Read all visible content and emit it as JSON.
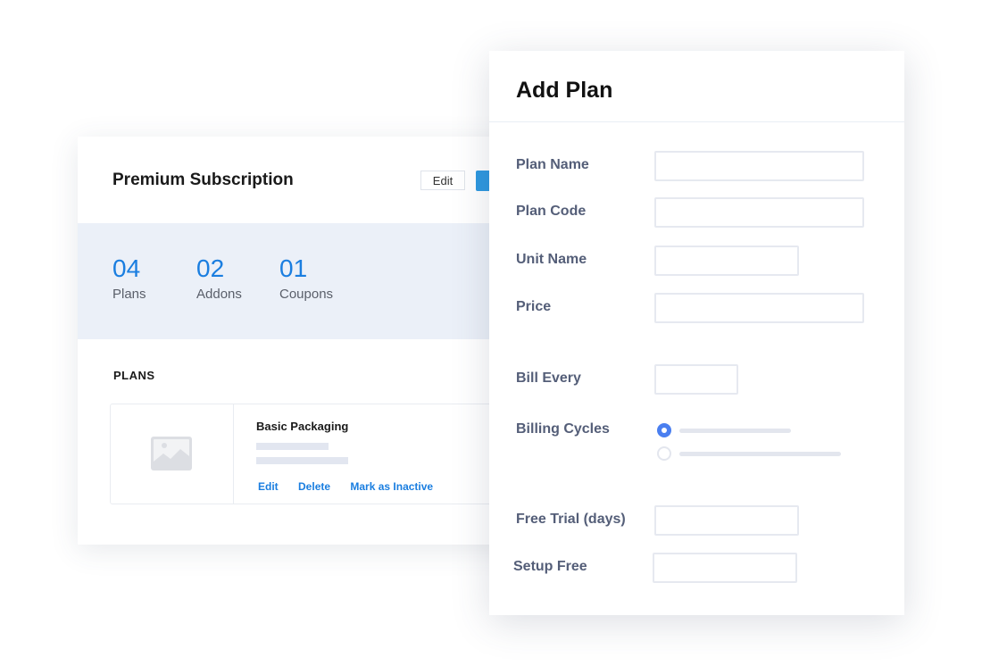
{
  "subscription": {
    "title": "Premium Subscription",
    "edit_label": "Edit",
    "stats": [
      {
        "value": "04",
        "label": "Plans"
      },
      {
        "value": "02",
        "label": "Addons"
      },
      {
        "value": "01",
        "label": "Coupons"
      }
    ],
    "plans_heading": "PLANS",
    "plan": {
      "name": "Basic Packaging",
      "thumbnail_icon": "image-placeholder-icon",
      "actions": [
        "Edit",
        "Delete",
        "Mark as Inactive"
      ]
    }
  },
  "add_plan": {
    "title": "Add Plan",
    "fields": {
      "plan_name": {
        "label": "Plan Name",
        "value": ""
      },
      "plan_code": {
        "label": "Plan Code",
        "value": ""
      },
      "unit_name": {
        "label": "Unit Name",
        "value": ""
      },
      "price": {
        "label": "Price",
        "value": ""
      },
      "bill_every": {
        "label": "Bill Every",
        "value": ""
      },
      "billing_cycles": {
        "label": "Billing Cycles",
        "selected_option": 0
      },
      "free_trial": {
        "label": "Free Trial (days)",
        "value": ""
      },
      "setup_free": {
        "label": "Setup Free",
        "value": ""
      }
    }
  },
  "colors": {
    "accent": "#1a7ee0",
    "radio_active": "#4a7ff0",
    "stats_bg": "#ebf0f8"
  }
}
